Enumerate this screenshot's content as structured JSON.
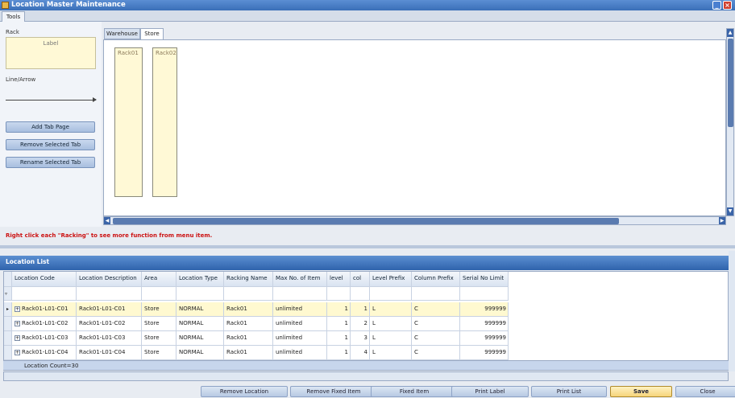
{
  "window": {
    "title": "Location Master Maintenance"
  },
  "ribbon": {
    "tab": "Tools"
  },
  "tools": {
    "rack_label": "Rack",
    "label_box": "Label",
    "line_label": "Line/Arrow",
    "buttons": [
      "Add Tab Page",
      "Remove Selected Tab",
      "Rename Selected Tab"
    ]
  },
  "designer": {
    "tabs": [
      "Warehouse",
      "Store"
    ],
    "active_tab": "Store",
    "racks": [
      "Rack01",
      "Rack02"
    ]
  },
  "hint": "Right click each \"Racking\" to see more function from menu item.",
  "location_list": {
    "title": "Location List",
    "columns": [
      "Location Code",
      "Location Description",
      "Area",
      "Location Type",
      "Racking Name",
      "Max No. of Item",
      "level",
      "col",
      "Level Prefix",
      "Column Prefix",
      "Serial No Limit"
    ],
    "rows": [
      [
        "Rack01-L01-C01",
        "Rack01-L01-C01",
        "Store",
        "NORMAL",
        "Rack01",
        "unlimited",
        "1",
        "1",
        "L",
        "C",
        "999999"
      ],
      [
        "Rack01-L01-C02",
        "Rack01-L01-C02",
        "Store",
        "NORMAL",
        "Rack01",
        "unlimited",
        "1",
        "2",
        "L",
        "C",
        "999999"
      ],
      [
        "Rack01-L01-C03",
        "Rack01-L01-C03",
        "Store",
        "NORMAL",
        "Rack01",
        "unlimited",
        "1",
        "3",
        "L",
        "C",
        "999999"
      ],
      [
        "Rack01-L01-C04",
        "Rack01-L01-C04",
        "Store",
        "NORMAL",
        "Rack01",
        "unlimited",
        "1",
        "4",
        "L",
        "C",
        "999999"
      ]
    ],
    "count": "Location Count=30"
  },
  "actions": [
    "Remove Location",
    "Remove Fixed Item",
    "Fixed Item",
    "Print Label",
    "Print List",
    "Save",
    "Close"
  ],
  "colors": {
    "accent": "#3a6fb8",
    "selected_row": "#fff9d0",
    "hint": "#cc1111"
  }
}
